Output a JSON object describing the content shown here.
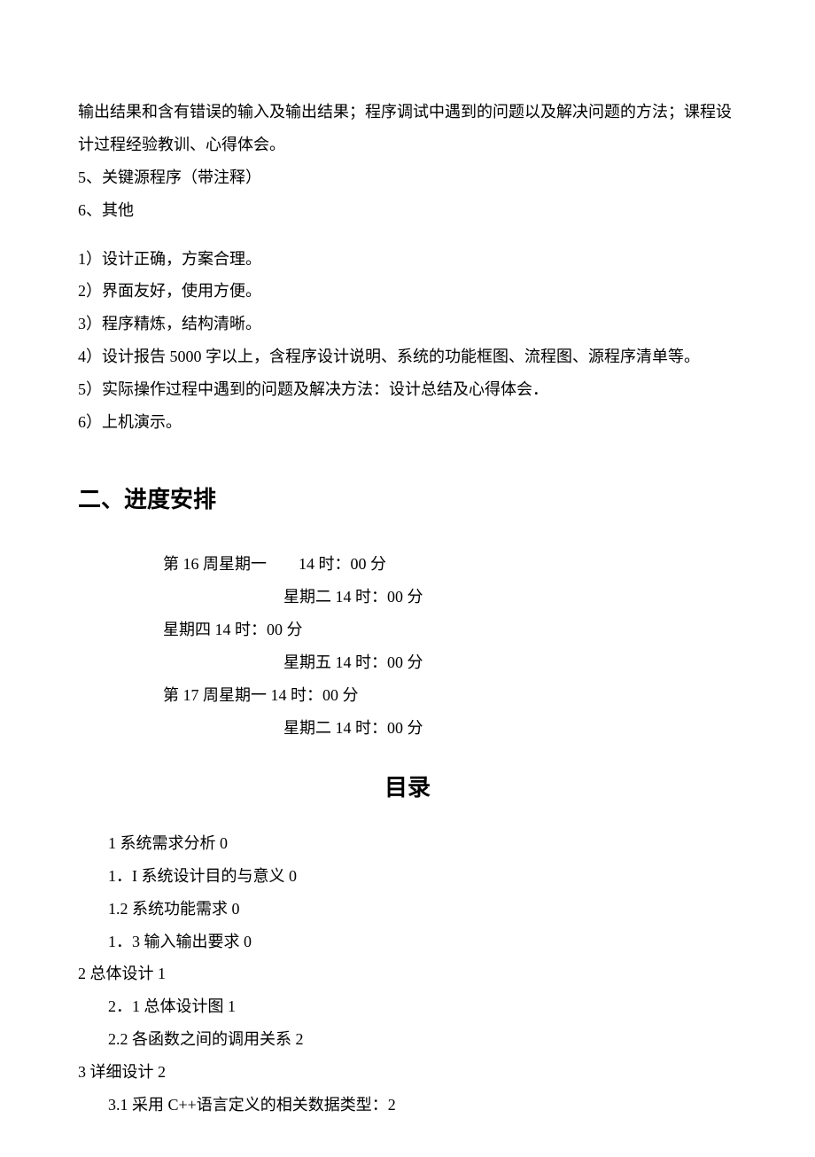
{
  "intro": {
    "p1": "输出结果和含有错误的输入及输出结果；程序调试中遇到的问题以及解决问题的方法；课程设计过程经验教训、心得体会。",
    "p2": "5、关键源程序（带注释）",
    "p3": "6、其他"
  },
  "requirements": [
    "1）设计正确，方案合理。",
    "2）界面友好，使用方便。",
    "3）程序精炼，结构清晰。",
    "4）设计报告 5000 字以上，含程序设计说明、系统的功能框图、流程图、源程序清单等。",
    "5）实际操作过程中遇到的问题及解决方法：设计总结及心得体会．",
    "6）上机演示。"
  ],
  "section_heading": "二、进度安排",
  "schedule": [
    {
      "indent": 1,
      "text": "第 16 周星期一　　14 时：00 分"
    },
    {
      "indent": 2,
      "text": "星期二 14 时：00 分"
    },
    {
      "indent": 1,
      "text": "星期四 14 时：00 分"
    },
    {
      "indent": 2,
      "text": "星期五 14 时：00 分"
    },
    {
      "indent": 1,
      "text": "第 17 周星期一 14 时：00 分"
    },
    {
      "indent": 2,
      "text": "星期二 14 时：00 分"
    }
  ],
  "toc_title": "目录",
  "toc": [
    {
      "level": 1,
      "text": "1 系统需求分析 0"
    },
    {
      "level": 1,
      "text": "1．I 系统设计目的与意义 0"
    },
    {
      "level": 1,
      "text": "1.2 系统功能需求 0"
    },
    {
      "level": 1,
      "text": "1．3 输入输出要求 0"
    },
    {
      "level": 0,
      "text": "2 总体设计 1"
    },
    {
      "level": 1,
      "text": "2．1 总体设计图 1"
    },
    {
      "level": 1,
      "text": "2.2 各函数之间的调用关系 2"
    },
    {
      "level": 0,
      "text": "3 详细设计 2"
    },
    {
      "level": 1,
      "text": "3.1 采用 C++语言定义的相关数据类型：2"
    }
  ]
}
